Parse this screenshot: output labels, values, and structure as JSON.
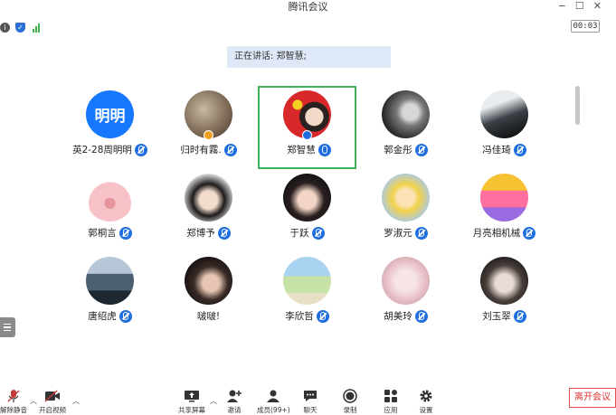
{
  "window": {
    "title": "腾讯会议"
  },
  "status": {
    "timer": "00:03",
    "signal_color": "#3bb34a",
    "shield_color": "#2b6fd6"
  },
  "speaking": {
    "label": "正在讲话: 郑智慧;"
  },
  "participants": [
    {
      "name": "英2-28周明明",
      "avatar_text": "明明",
      "muted": true
    },
    {
      "name": "归时有霧.",
      "muted": true,
      "badge": "host"
    },
    {
      "name": "郑智慧",
      "muted": false,
      "active_speaker": true,
      "badge": "cohost"
    },
    {
      "name": "郭金彤",
      "muted": true
    },
    {
      "name": "冯佳琦",
      "muted": true
    },
    {
      "name": "郭桐言",
      "muted": true
    },
    {
      "name": "郑博予",
      "muted": true
    },
    {
      "name": "于跃",
      "muted": true
    },
    {
      "name": "罗淑元",
      "muted": true
    },
    {
      "name": "月亮相机械",
      "muted": true
    },
    {
      "name": "唐绍虎",
      "muted": true
    },
    {
      "name": "啵啵!",
      "muted": false
    },
    {
      "name": "李欣哲",
      "muted": true
    },
    {
      "name": "胡美玲",
      "muted": true
    },
    {
      "name": "刘玉翠",
      "muted": true
    }
  ],
  "toolbar": {
    "unmute": "解除静音",
    "start_video": "开启视频",
    "share_screen": "共享屏幕",
    "invite": "邀请",
    "members": "成员(99+)",
    "chat": "聊天",
    "record": "录制",
    "apps": "应用",
    "settings": "设置",
    "leave": "离开会议"
  }
}
